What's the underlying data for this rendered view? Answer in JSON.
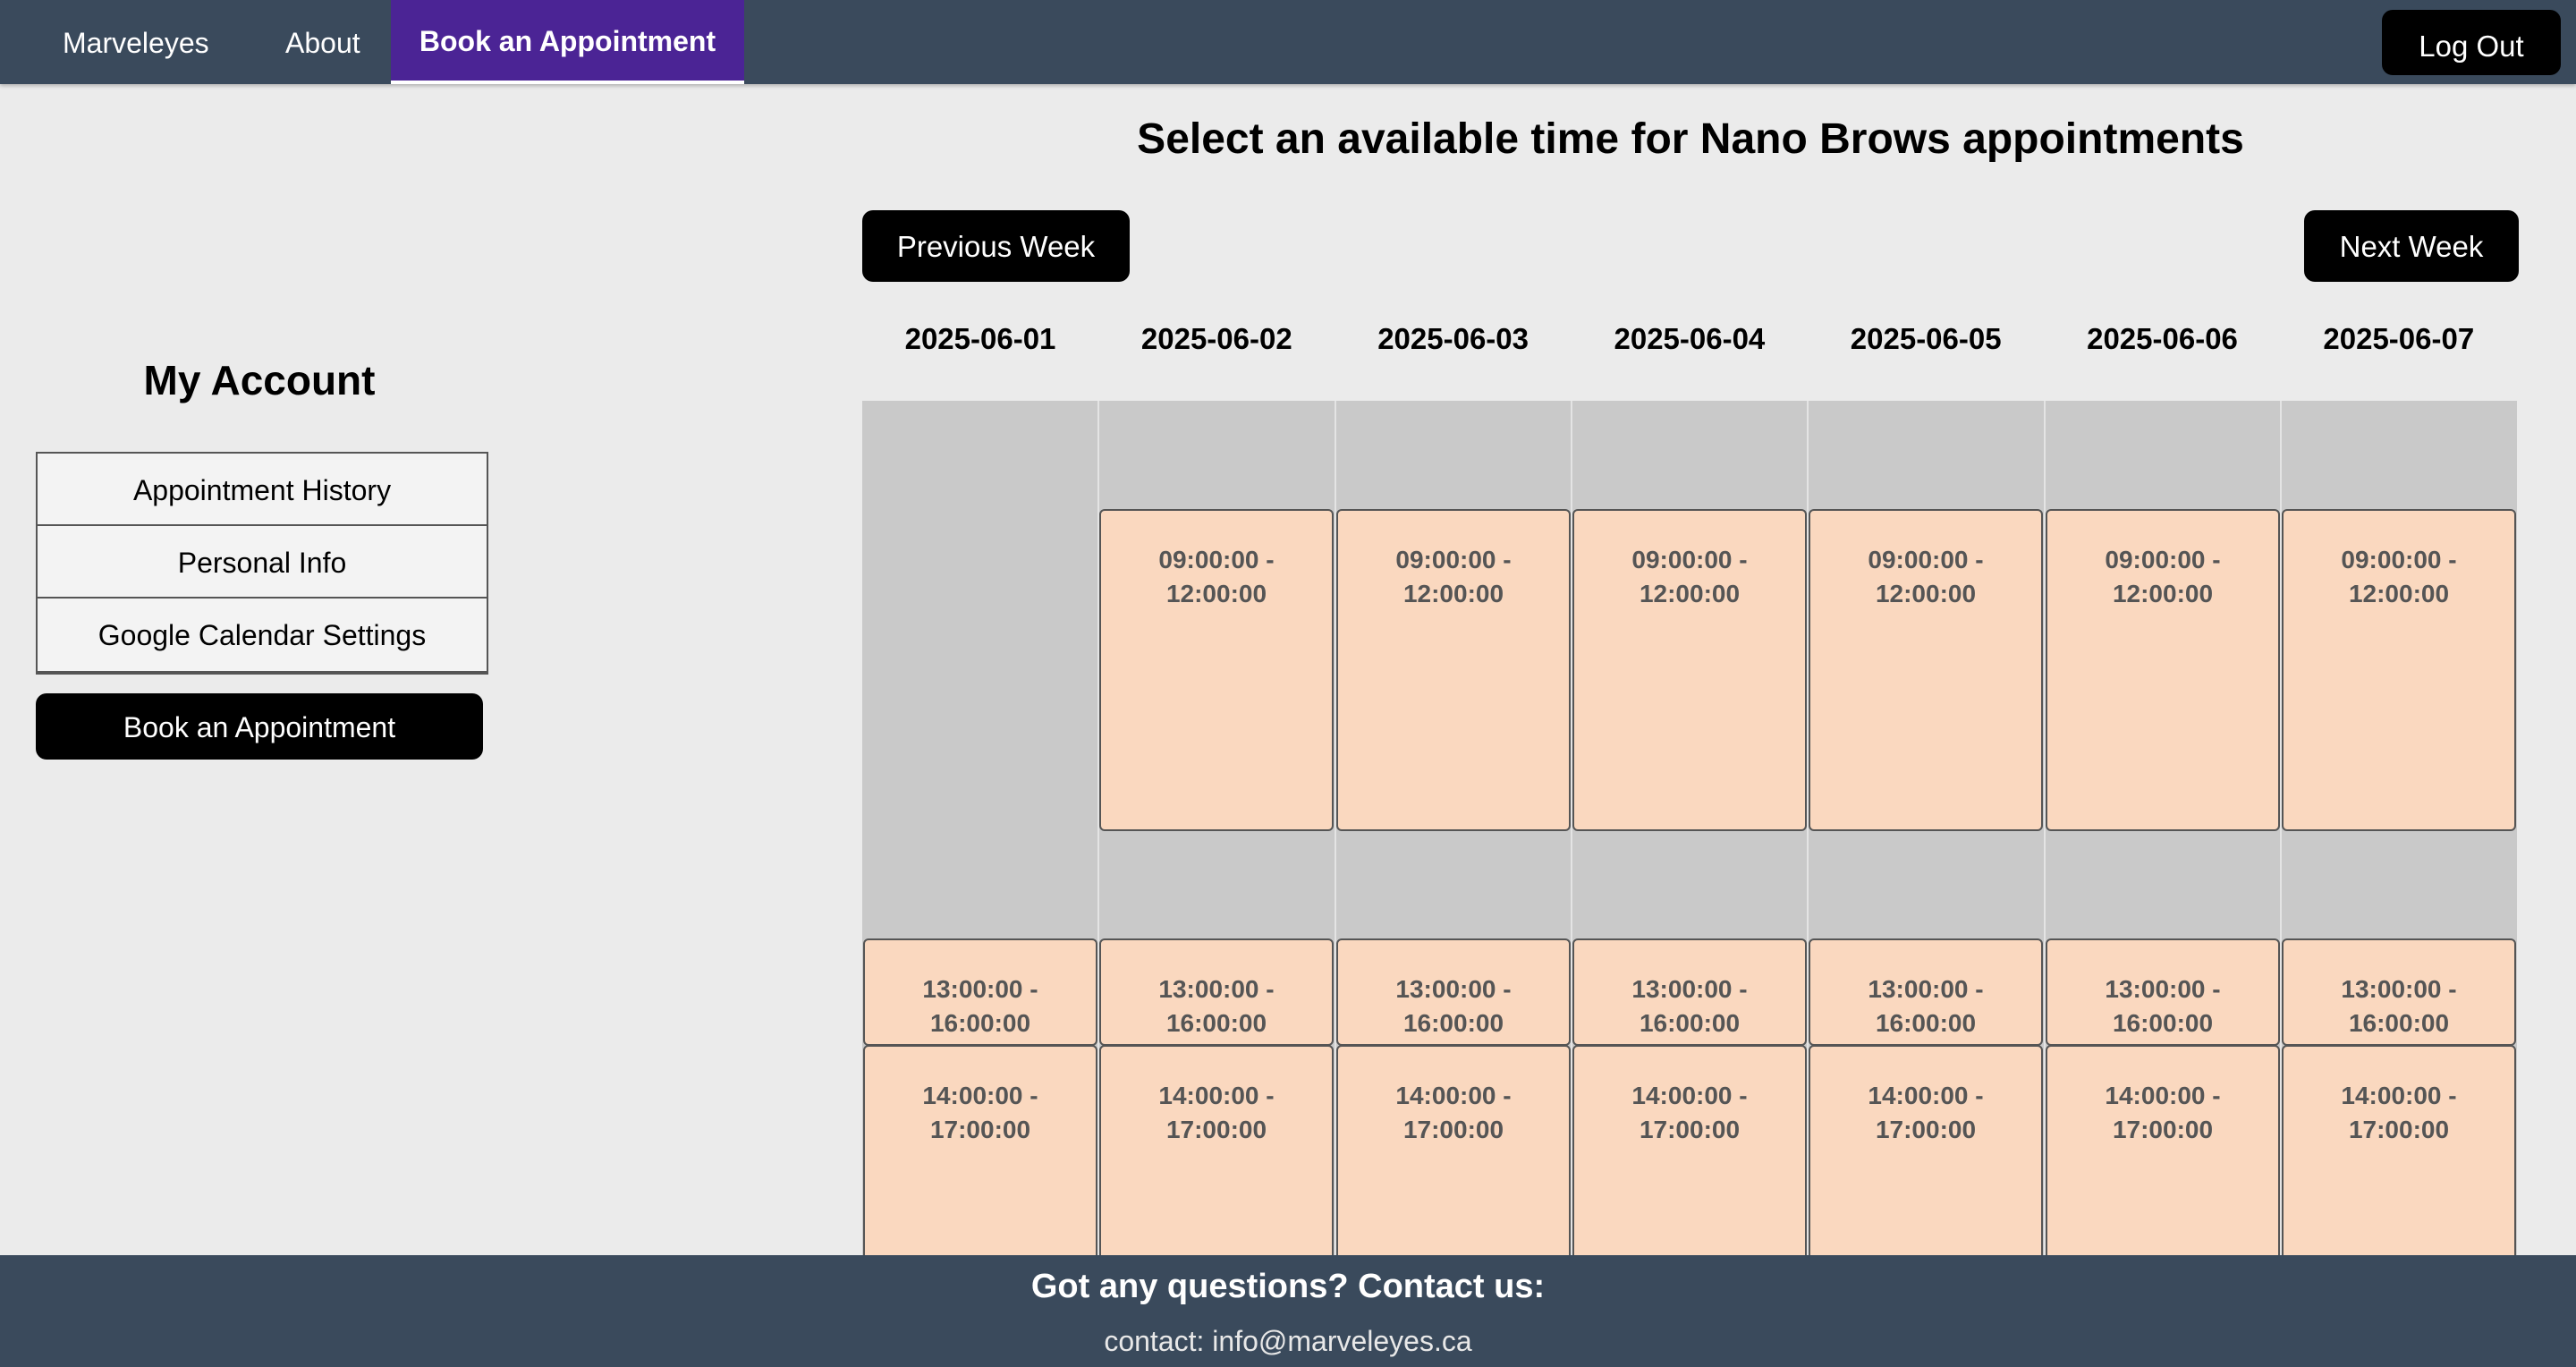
{
  "nav": {
    "brand": "Marveleyes",
    "about": "About",
    "active": "Book an Appointment",
    "logout": "Log Out"
  },
  "sidebar": {
    "title": "My Account",
    "items": [
      {
        "label": "Appointment History"
      },
      {
        "label": "Personal Info"
      },
      {
        "label": "Google Calendar Settings"
      }
    ],
    "book_button": "Book an Appointment"
  },
  "main": {
    "title": "Select an available time for Nano Brows appointments",
    "prev_week": "Previous Week",
    "next_week": "Next Week",
    "days": [
      {
        "date": "2025-06-01",
        "slots": [
          {
            "start": "13:00:00 -",
            "end": "16:00:00",
            "row": "afternoon1"
          },
          {
            "start": "14:00:00 -",
            "end": "17:00:00",
            "row": "afternoon2"
          }
        ]
      },
      {
        "date": "2025-06-02",
        "slots": [
          {
            "start": "09:00:00 -",
            "end": "12:00:00",
            "row": "morning"
          },
          {
            "start": "13:00:00 -",
            "end": "16:00:00",
            "row": "afternoon1"
          },
          {
            "start": "14:00:00 -",
            "end": "17:00:00",
            "row": "afternoon2"
          }
        ]
      },
      {
        "date": "2025-06-03",
        "slots": [
          {
            "start": "09:00:00 -",
            "end": "12:00:00",
            "row": "morning"
          },
          {
            "start": "13:00:00 -",
            "end": "16:00:00",
            "row": "afternoon1"
          },
          {
            "start": "14:00:00 -",
            "end": "17:00:00",
            "row": "afternoon2"
          }
        ]
      },
      {
        "date": "2025-06-04",
        "slots": [
          {
            "start": "09:00:00 -",
            "end": "12:00:00",
            "row": "morning"
          },
          {
            "start": "13:00:00 -",
            "end": "16:00:00",
            "row": "afternoon1"
          },
          {
            "start": "14:00:00 -",
            "end": "17:00:00",
            "row": "afternoon2"
          }
        ]
      },
      {
        "date": "2025-06-05",
        "slots": [
          {
            "start": "09:00:00 -",
            "end": "12:00:00",
            "row": "morning"
          },
          {
            "start": "13:00:00 -",
            "end": "16:00:00",
            "row": "afternoon1"
          },
          {
            "start": "14:00:00 -",
            "end": "17:00:00",
            "row": "afternoon2"
          }
        ]
      },
      {
        "date": "2025-06-06",
        "slots": [
          {
            "start": "09:00:00 -",
            "end": "12:00:00",
            "row": "morning"
          },
          {
            "start": "13:00:00 -",
            "end": "16:00:00",
            "row": "afternoon1"
          },
          {
            "start": "14:00:00 -",
            "end": "17:00:00",
            "row": "afternoon2"
          }
        ]
      },
      {
        "date": "2025-06-07",
        "slots": [
          {
            "start": "09:00:00 -",
            "end": "12:00:00",
            "row": "morning"
          },
          {
            "start": "13:00:00 -",
            "end": "16:00:00",
            "row": "afternoon1"
          },
          {
            "start": "14:00:00 -",
            "end": "17:00:00",
            "row": "afternoon2"
          }
        ]
      }
    ]
  },
  "footer": {
    "title": "Got any questions? Contact us:",
    "contact": "contact: info@marveleyes.ca"
  },
  "colors": {
    "nav_bg": "#3a4a5c",
    "active_tab": "#4b2495",
    "slot_bg": "#fad8bf",
    "grid_bg": "#c9c9c9"
  }
}
